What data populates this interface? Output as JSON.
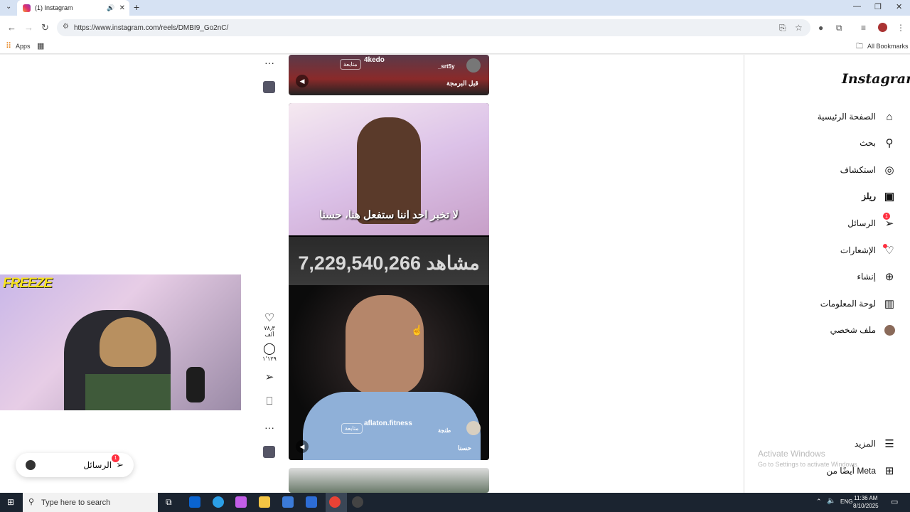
{
  "browser": {
    "tab_title": "(1) Instagram",
    "url": "https://www.instagram.com/reels/DMBI9_Go2nC/",
    "bookmarks": {
      "apps": "Apps",
      "all": "All Bookmarks"
    }
  },
  "sidebar": {
    "logo": "Instagram",
    "items": [
      {
        "label": "الصفحة الرئيسية",
        "icon": "home-icon"
      },
      {
        "label": "بحث",
        "icon": "search-icon"
      },
      {
        "label": "استكشاف",
        "icon": "compass-icon"
      },
      {
        "label": "ريلز",
        "icon": "reels-icon"
      },
      {
        "label": "الرسائل",
        "icon": "send-icon",
        "badge": "1"
      },
      {
        "label": "الإشعارات",
        "icon": "heart-icon"
      },
      {
        "label": "إنشاء",
        "icon": "plus-square-icon"
      },
      {
        "label": "لوحة المعلومات",
        "icon": "dashboard-icon"
      },
      {
        "label": "ملف شخصي",
        "icon": "avatar-icon"
      }
    ],
    "more": "المزيد",
    "meta": "أيضًا من Meta"
  },
  "reels": {
    "top": {
      "username": "_srt5y",
      "caption": "قبل البرمجة",
      "follow": "متابعة",
      "overlay": "4kedo"
    },
    "main": {
      "subtitle": "لا تخبر احد اننا ستفعل هنا، حسنا",
      "views": "7,229,540,266 مشاهد",
      "username": "aflaton.fitness",
      "follow": "متابعة",
      "location": "طنجة",
      "caption": "حسنا"
    }
  },
  "actions": {
    "likes": "٧٨٫٣ ألف",
    "comments": "١٬١٢٩"
  },
  "webcam": {
    "overlay": "FREEZE"
  },
  "messages_pill": {
    "label": "الرسائل",
    "badge": "1"
  },
  "watermark": {
    "line1": "Activate Windows",
    "line2": "Go to Settings to activate Windows."
  },
  "taskbar": {
    "search_placeholder": "Type here to search",
    "lang": "ENG",
    "time": "11:36 AM",
    "date": "8/10/2025"
  }
}
